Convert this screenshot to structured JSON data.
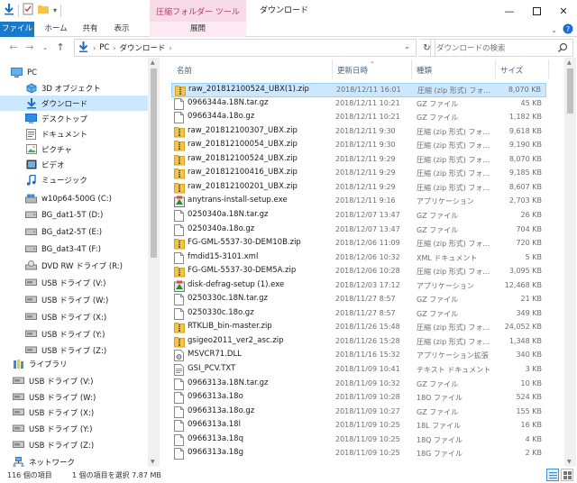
{
  "titlebar": {
    "context_tab": "圧縮フォルダー ツール",
    "window_title": "ダウンロード"
  },
  "ribbon": {
    "tabs": [
      "ファイル",
      "ホーム",
      "共有",
      "表示",
      "展開"
    ]
  },
  "address": {
    "crumbs": [
      "PC",
      "ダウンロード"
    ],
    "search_placeholder": "ダウンロードの検索"
  },
  "nav": {
    "items": [
      {
        "label": "PC",
        "icon": "pc-icon",
        "level": 0
      },
      {
        "label": "3D オブジェクト",
        "icon": "3d-objects-icon",
        "level": 1
      },
      {
        "label": "ダウンロード",
        "icon": "download-folder-icon",
        "level": 1,
        "selected": true
      },
      {
        "label": "デスクトップ",
        "icon": "desktop-icon",
        "level": 1
      },
      {
        "label": "ドキュメント",
        "icon": "documents-icon",
        "level": 1
      },
      {
        "label": "ピクチャ",
        "icon": "pictures-icon",
        "level": 1
      },
      {
        "label": "ビデオ",
        "icon": "video-icon",
        "level": 1
      },
      {
        "label": "ミュージック",
        "icon": "music-icon",
        "level": 1
      },
      {
        "label": "w10p64-500G (C:)",
        "icon": "system-drive-icon",
        "level": 1
      },
      {
        "label": "BG_dat1-5T (D:)",
        "icon": "drive-icon",
        "level": 1
      },
      {
        "label": "BG_dat2-5T (E:)",
        "icon": "drive-icon",
        "level": 1
      },
      {
        "label": "BG_dat3-4T (F:)",
        "icon": "drive-icon",
        "level": 1
      },
      {
        "label": "DVD RW ドライブ (R:)",
        "icon": "dvd-drive-icon",
        "level": 1
      },
      {
        "label": "USB ドライブ (V:)",
        "icon": "usb-drive-icon",
        "level": 1
      },
      {
        "label": "USB ドライブ (W:)",
        "icon": "usb-drive-icon",
        "level": 1
      },
      {
        "label": "USB ドライブ (X:)",
        "icon": "usb-drive-icon",
        "level": 1
      },
      {
        "label": "USB ドライブ (Y:)",
        "icon": "usb-drive-icon",
        "level": 1
      },
      {
        "label": "USB ドライブ (Z:)",
        "icon": "usb-drive-icon",
        "level": 1
      },
      {
        "label": "ライブラリ",
        "icon": "library-icon",
        "level": 0
      },
      {
        "label": "USB ドライブ (V:)",
        "icon": "usb-drive-icon",
        "level": 0
      },
      {
        "label": "USB ドライブ (W:)",
        "icon": "usb-drive-icon",
        "level": 0
      },
      {
        "label": "USB ドライブ (X:)",
        "icon": "usb-drive-icon",
        "level": 0
      },
      {
        "label": "USB ドライブ (Y:)",
        "icon": "usb-drive-icon",
        "level": 0
      },
      {
        "label": "USB ドライブ (Z:)",
        "icon": "usb-drive-icon",
        "level": 0
      },
      {
        "label": "ネットワーク",
        "icon": "network-icon",
        "level": 0
      }
    ]
  },
  "columns": {
    "name": "名前",
    "date": "更新日時",
    "type": "種類",
    "size": "サイズ"
  },
  "files": [
    {
      "name": "raw_201812100524_UBX(1).zip",
      "date": "2018/12/11 16:01",
      "type": "圧縮 (zip 形式) フォ...",
      "size": "8,070 KB",
      "icon": "zip-folder-icon",
      "selected": true
    },
    {
      "name": "0966344a.18N.tar.gz",
      "date": "2018/12/11 10:21",
      "type": "GZ ファイル",
      "size": "45 KB",
      "icon": "file-icon"
    },
    {
      "name": "0966344a.18o.gz",
      "date": "2018/12/11 10:21",
      "type": "GZ ファイル",
      "size": "1,182 KB",
      "icon": "file-icon"
    },
    {
      "name": "raw_201812100307_UBX.zip",
      "date": "2018/12/11 9:30",
      "type": "圧縮 (zip 形式) フォ...",
      "size": "9,618 KB",
      "icon": "zip-folder-icon"
    },
    {
      "name": "raw_201812100054_UBX.zip",
      "date": "2018/12/11 9:30",
      "type": "圧縮 (zip 形式) フォ...",
      "size": "9,190 KB",
      "icon": "zip-folder-icon"
    },
    {
      "name": "raw_201812100524_UBX.zip",
      "date": "2018/12/11 9:29",
      "type": "圧縮 (zip 形式) フォ...",
      "size": "8,070 KB",
      "icon": "zip-folder-icon"
    },
    {
      "name": "raw_201812100416_UBX.zip",
      "date": "2018/12/11 9:29",
      "type": "圧縮 (zip 形式) フォ...",
      "size": "9,185 KB",
      "icon": "zip-folder-icon"
    },
    {
      "name": "raw_201812100201_UBX.zip",
      "date": "2018/12/11 9:29",
      "type": "圧縮 (zip 形式) フォ...",
      "size": "8,607 KB",
      "icon": "zip-folder-icon"
    },
    {
      "name": "anytrans-install-setup.exe",
      "date": "2018/12/11 9:16",
      "type": "アプリケーション",
      "size": "2,703 KB",
      "icon": "installer-icon"
    },
    {
      "name": "0250340a.18N.tar.gz",
      "date": "2018/12/07 13:47",
      "type": "GZ ファイル",
      "size": "26 KB",
      "icon": "file-icon"
    },
    {
      "name": "0250340a.18o.gz",
      "date": "2018/12/07 13:47",
      "type": "GZ ファイル",
      "size": "704 KB",
      "icon": "file-icon"
    },
    {
      "name": "FG-GML-5537-30-DEM10B.zip",
      "date": "2018/12/06 11:09",
      "type": "圧縮 (zip 形式) フォ...",
      "size": "720 KB",
      "icon": "zip-folder-icon"
    },
    {
      "name": "fmdid15-3101.xml",
      "date": "2018/12/06 10:32",
      "type": "XML ドキュメント",
      "size": "5 KB",
      "icon": "file-icon"
    },
    {
      "name": "FG-GML-5537-30-DEM5A.zip",
      "date": "2018/12/06 10:28",
      "type": "圧縮 (zip 形式) フォ...",
      "size": "3,095 KB",
      "icon": "zip-folder-icon"
    },
    {
      "name": "disk-defrag-setup (1).exe",
      "date": "2018/12/03 17:12",
      "type": "アプリケーション",
      "size": "12,468 KB",
      "icon": "installer-icon"
    },
    {
      "name": "0250330c.18N.tar.gz",
      "date": "2018/11/27 8:57",
      "type": "GZ ファイル",
      "size": "21 KB",
      "icon": "file-icon"
    },
    {
      "name": "0250330c.18o.gz",
      "date": "2018/11/27 8:57",
      "type": "GZ ファイル",
      "size": "349 KB",
      "icon": "file-icon"
    },
    {
      "name": "RTKLIB_bin-master.zip",
      "date": "2018/11/26 15:48",
      "type": "圧縮 (zip 形式) フォ...",
      "size": "24,052 KB",
      "icon": "zip-folder-icon"
    },
    {
      "name": "gsigeo2011_ver2_asc.zip",
      "date": "2018/11/26 15:28",
      "type": "圧縮 (zip 形式) フォ...",
      "size": "1,348 KB",
      "icon": "zip-folder-icon"
    },
    {
      "name": "MSVCR71.DLL",
      "date": "2018/11/16 15:32",
      "type": "アプリケーション拡張",
      "size": "340 KB",
      "icon": "dll-icon"
    },
    {
      "name": "GSI_PCV.TXT",
      "date": "2018/11/09 10:41",
      "type": "テキスト ドキュメント",
      "size": "3 KB",
      "icon": "text-file-icon"
    },
    {
      "name": "0966313a.18N.tar.gz",
      "date": "2018/11/09 10:32",
      "type": "GZ ファイル",
      "size": "10 KB",
      "icon": "file-icon"
    },
    {
      "name": "0966313a.18o",
      "date": "2018/11/09 10:28",
      "type": "18O ファイル",
      "size": "524 KB",
      "icon": "file-icon"
    },
    {
      "name": "0966313a.18o.gz",
      "date": "2018/11/09 10:27",
      "type": "GZ ファイル",
      "size": "155 KB",
      "icon": "file-icon"
    },
    {
      "name": "0966313a.18l",
      "date": "2018/11/09 10:25",
      "type": "18L ファイル",
      "size": "16 KB",
      "icon": "file-icon"
    },
    {
      "name": "0966313a.18q",
      "date": "2018/11/09 10:25",
      "type": "18Q ファイル",
      "size": "4 KB",
      "icon": "file-icon"
    },
    {
      "name": "0966313a.18g",
      "date": "2018/11/09 10:25",
      "type": "18G ファイル",
      "size": "2 KB",
      "icon": "file-icon"
    }
  ],
  "status": {
    "count": "116 個の項目",
    "selection": "1 個の項目を選択 7.87 MB"
  },
  "colors": {
    "file_tab": "#1979ca",
    "context_tab": "#f7dbe6",
    "selection": "#cce8ff",
    "zip_folder": "#f3c44b"
  }
}
